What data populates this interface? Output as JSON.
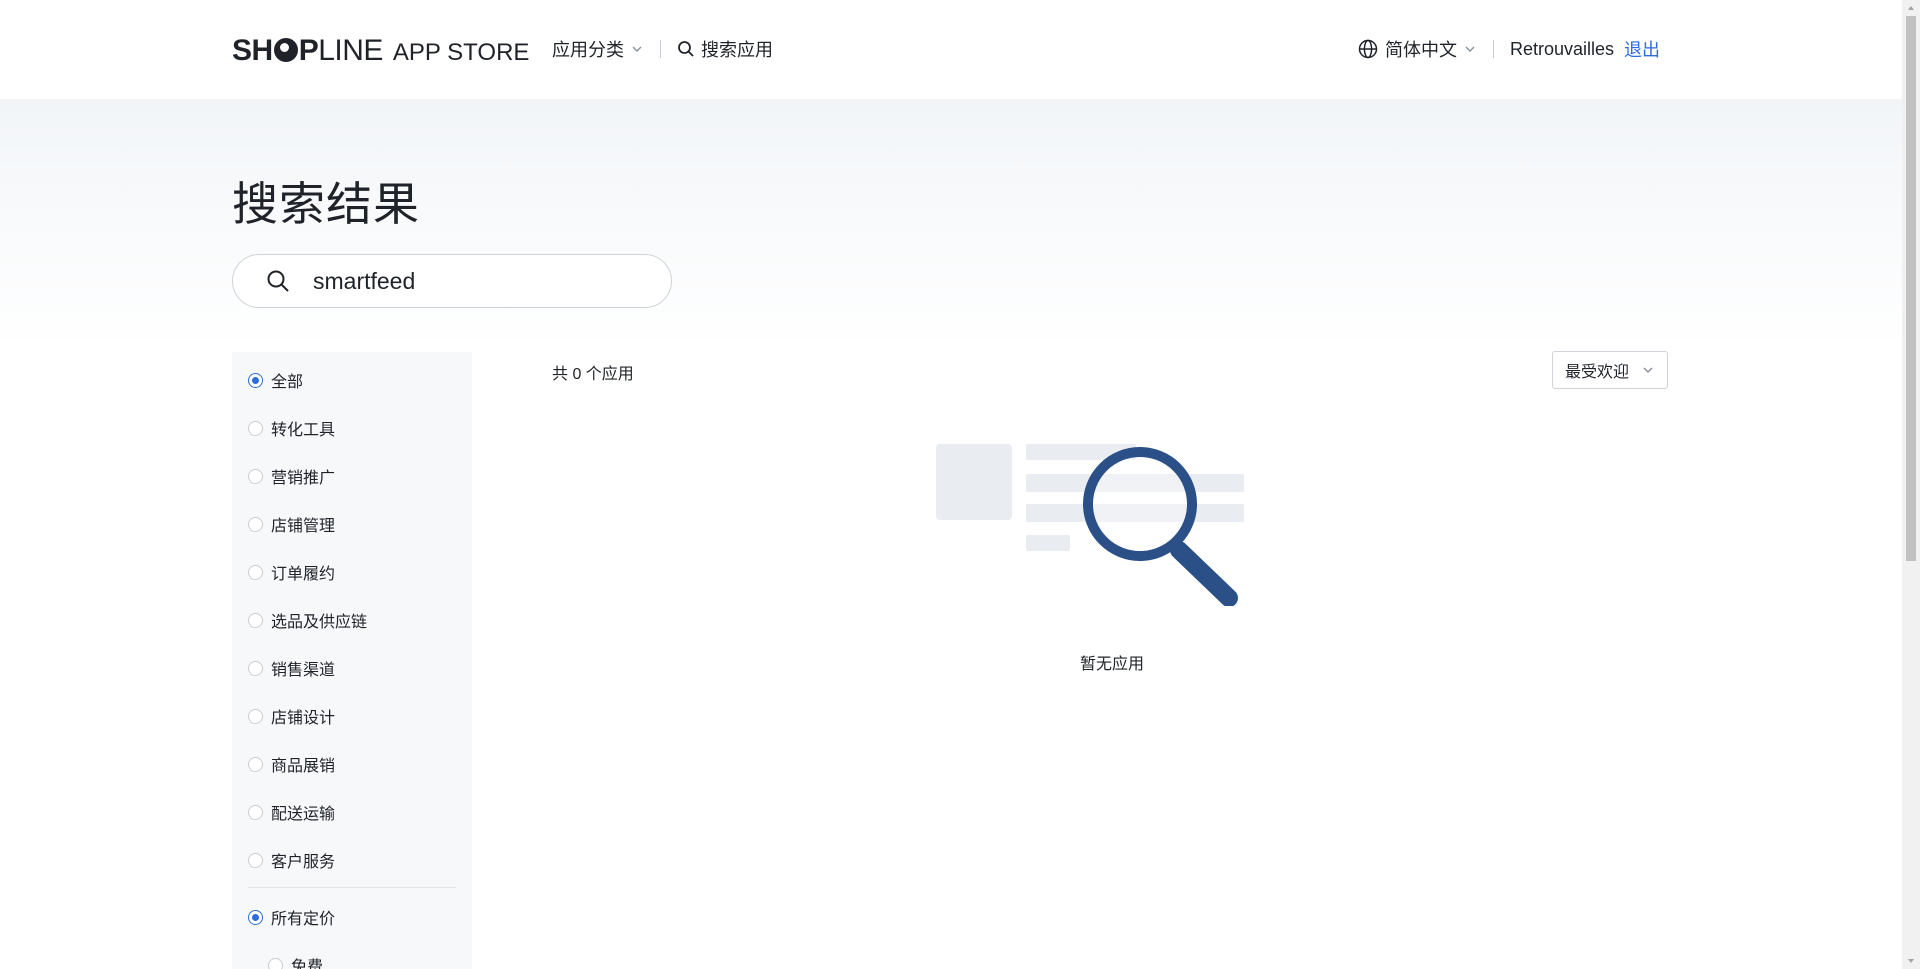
{
  "header": {
    "logo_brand_bold_1": "SH",
    "logo_brand_bold_2": "P",
    "logo_brand_light": "LINE",
    "logo_suffix": "APP STORE",
    "nav": {
      "categories_label": "应用分类",
      "search_label": "搜索应用"
    },
    "language_label": "简体中文",
    "user_name": "Retrouvailles",
    "logout_label": "退出"
  },
  "hero": {
    "title": "搜索结果",
    "search_value": "smartfeed"
  },
  "sidebar": {
    "categories": [
      {
        "label": "全部",
        "checked": true
      },
      {
        "label": "转化工具",
        "checked": false
      },
      {
        "label": "营销推广",
        "checked": false
      },
      {
        "label": "店铺管理",
        "checked": false
      },
      {
        "label": "订单履约",
        "checked": false
      },
      {
        "label": "选品及供应链",
        "checked": false
      },
      {
        "label": "销售渠道",
        "checked": false
      },
      {
        "label": "店铺设计",
        "checked": false
      },
      {
        "label": "商品展销",
        "checked": false
      },
      {
        "label": "配送运输",
        "checked": false
      },
      {
        "label": "客户服务",
        "checked": false
      }
    ],
    "pricing": [
      {
        "label": "所有定价",
        "checked": true
      },
      {
        "label": "免费",
        "checked": false
      }
    ]
  },
  "main": {
    "result_count": "共 0 个应用",
    "sort_label": "最受欢迎",
    "empty_text": "暂无应用"
  },
  "colors": {
    "accent": "#2f6bd9",
    "illustration_blue": "#2a5087",
    "placeholder_gray": "#e9ecf0"
  },
  "icons": [
    "chevron-down-icon",
    "search-icon",
    "globe-icon",
    "magnifier-illustration"
  ]
}
